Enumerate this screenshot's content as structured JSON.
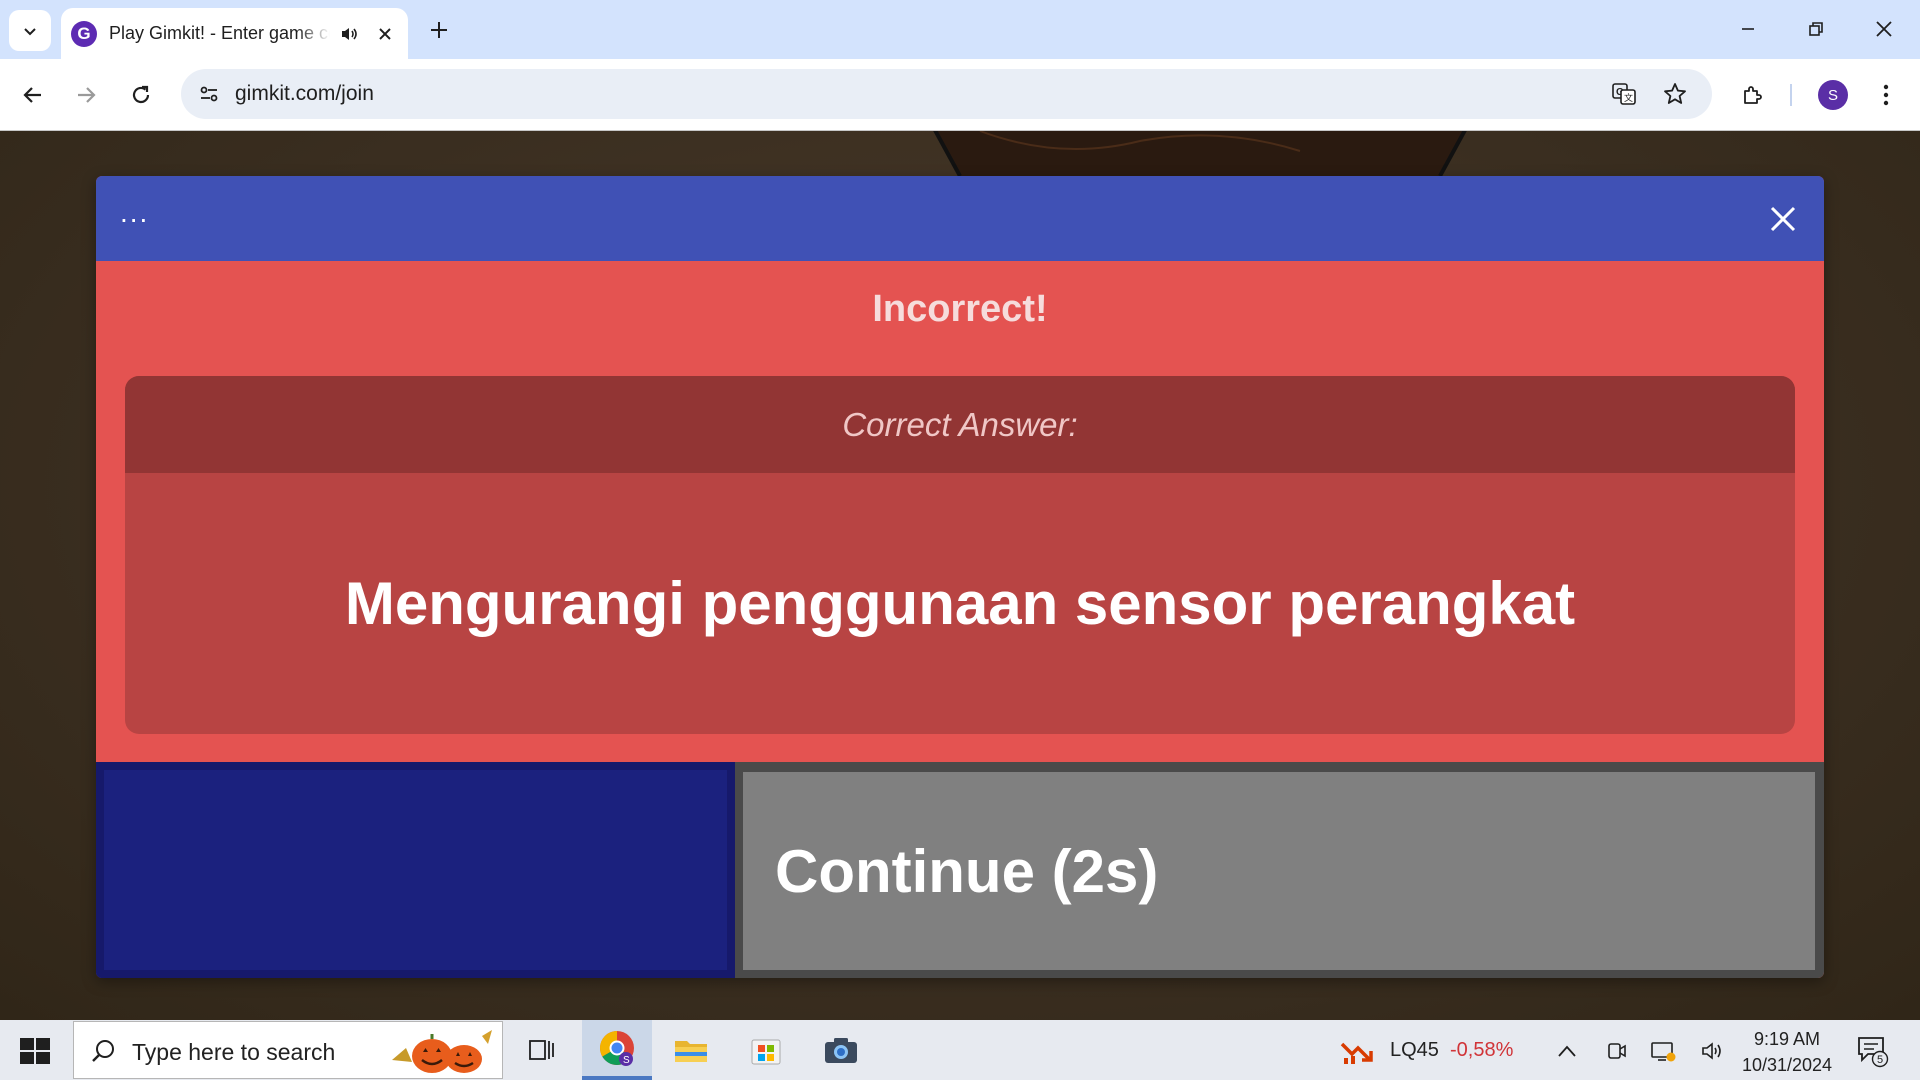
{
  "browser": {
    "tab_title": "Play Gimkit! - Enter game code",
    "favicon_letter": "G",
    "url": "gimkit.com/join",
    "profile_initial": "S"
  },
  "modal": {
    "menu_label": "...",
    "result_title": "Incorrect!",
    "correct_answer_label": "Correct Answer:",
    "correct_answer": "Mengurangi penggunaan sensor perangkat",
    "continue_label": "Continue (2s)",
    "countdown_progress": 0.37,
    "colors": {
      "header": "#4051b5",
      "incorrect_bg": "#e45351",
      "answer_box": "#b84443",
      "answer_head": "#923534",
      "progress": "#1b217e",
      "continue_button": "#808080"
    }
  },
  "taskbar": {
    "search_placeholder": "Type here to search",
    "stock_name": "LQ45",
    "stock_change": "-0,58%",
    "time": "9:19 AM",
    "date": "10/31/2024",
    "notification_count": "5"
  }
}
